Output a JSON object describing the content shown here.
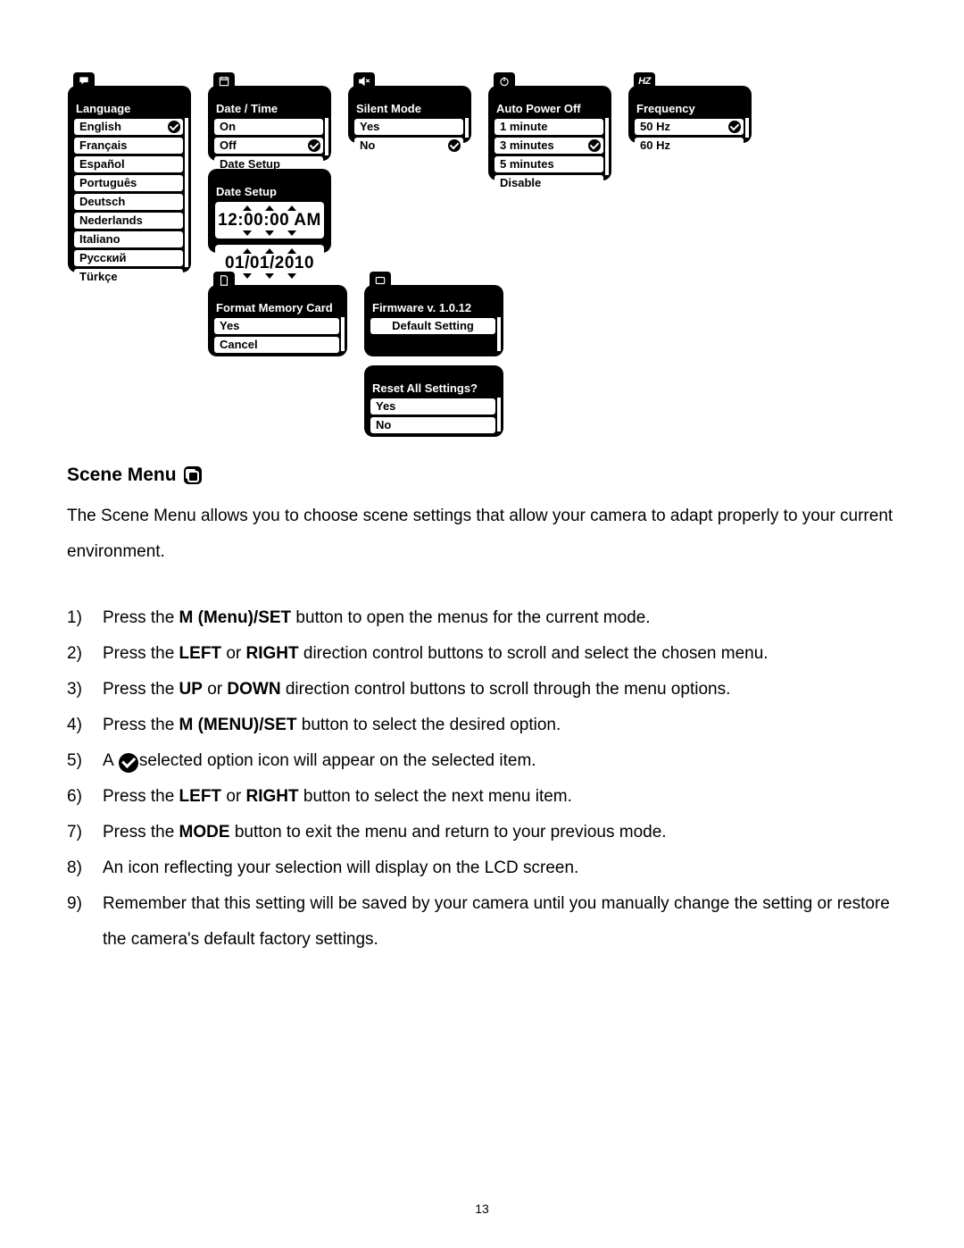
{
  "page_number": "13",
  "menus": {
    "language": {
      "title": "Language",
      "options": [
        "English",
        "Français",
        "Español",
        "Português",
        "Deutsch",
        "Nederlands",
        "Italiano",
        "Русский",
        "Türkçe"
      ],
      "selected_index": 0
    },
    "datetime": {
      "title": "Date / Time",
      "options": [
        "On",
        "Off",
        "Date Setup"
      ],
      "selected_index": 1
    },
    "datesetup": {
      "title": "Date Setup",
      "time": "12:00:00 AM",
      "date": "01/01/2010"
    },
    "silent": {
      "title": "Silent Mode",
      "options": [
        "Yes",
        "No"
      ],
      "selected_index": 1
    },
    "autopoweroff": {
      "title": "Auto Power Off",
      "options": [
        "1 minute",
        "3 minutes",
        "5 minutes",
        "Disable"
      ],
      "selected_index": 1
    },
    "frequency": {
      "title": "Frequency",
      "options": [
        "50 Hz",
        "60 Hz"
      ],
      "selected_index": 0
    },
    "format": {
      "title": "Format Memory Card",
      "options": [
        "Yes",
        "Cancel"
      ]
    },
    "firmware": {
      "title": "Firmware v. 1.0.12",
      "options": [
        "Default Setting"
      ]
    },
    "reset": {
      "title": "Reset All Settings?",
      "options": [
        "Yes",
        "No"
      ]
    }
  },
  "section": {
    "heading": "Scene Menu",
    "intro": "The Scene Menu allows you to choose scene settings that allow your camera to adapt properly to your current environment.",
    "steps": {
      "s1a": "Press the ",
      "s1b": "M (Menu)/SET",
      "s1c": " button to open the menus for the current mode.",
      "s2a": "Press the ",
      "s2b": "LEFT",
      "s2c": " or ",
      "s2d": "RIGHT",
      "s2e": " direction control buttons to scroll and select the chosen menu.",
      "s3a": "Press the ",
      "s3b": "UP",
      "s3c": " or ",
      "s3d": "DOWN",
      "s3e": " direction control buttons to scroll through the menu options.",
      "s4a": "Press the ",
      "s4b": "M (MENU)/SET",
      "s4c": " button to select the desired option.",
      "s5a": "A ",
      "s5b": "selected option icon will appear on the selected item.",
      "s6a": "Press the ",
      "s6b": "LEFT",
      "s6c": " or ",
      "s6d": "RIGHT",
      "s6e": " button to select the next menu item.",
      "s7a": "Press the ",
      "s7b": "MODE",
      "s7c": " button to exit the menu and return to your previous mode.",
      "s8": "An icon reflecting your selection will display on the LCD screen.",
      "s9": "Remember that this setting will be saved by your camera until you manually change the setting or restore the camera's default factory settings."
    }
  }
}
